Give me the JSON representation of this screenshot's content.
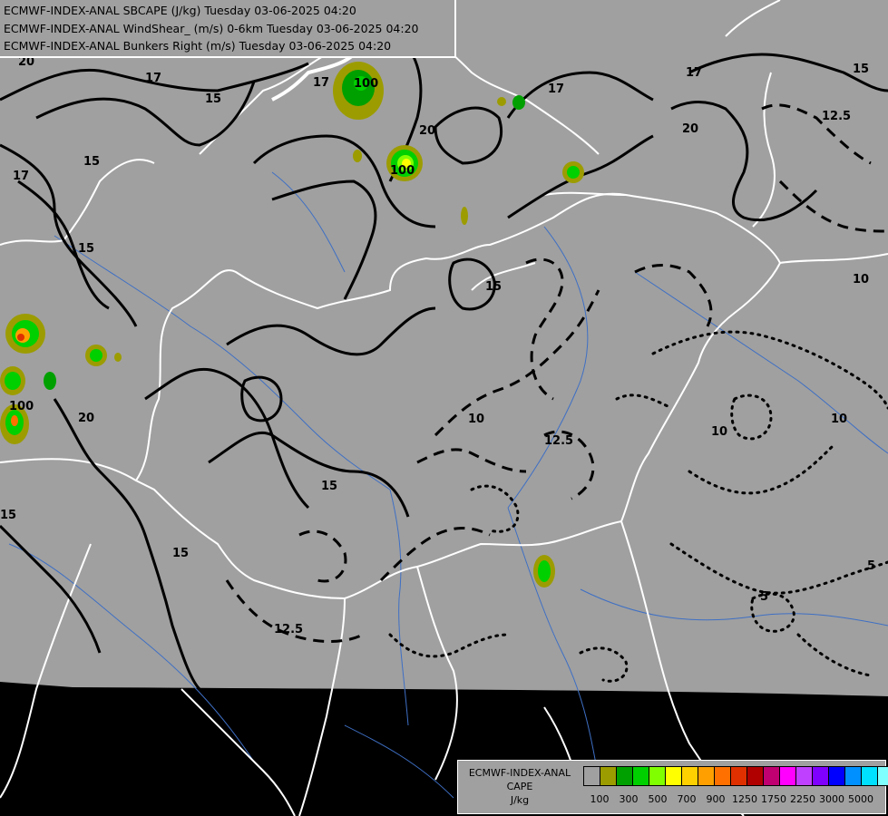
{
  "header": {
    "line1": "ECMWF-INDEX-ANAL SBCAPE (J/kg) Tuesday 03-06-2025 04:20",
    "line2": "ECMWF-INDEX-ANAL WindShear_ (m/s) 0-6km Tuesday 03-06-2025 04:20",
    "line3": "ECMWF-INDEX-ANAL Bunkers Right (m/s) Tuesday 03-06-2025 04:20"
  },
  "contour_labels": [
    "20",
    "17",
    "15",
    "17",
    "15",
    "17",
    "20",
    "17",
    "12.5",
    "15",
    "17",
    "15",
    "15",
    "20",
    "100",
    "100",
    "15",
    "15",
    "12.5",
    "12.5",
    "10",
    "10",
    "10",
    "10",
    "5",
    "5",
    "20",
    "15",
    "100"
  ],
  "legend": {
    "line1": "ECMWF-INDEX-ANAL",
    "line2": "CAPE",
    "line3": "J/kg",
    "colors": [
      "#a0a0a0",
      "#9c9c00",
      "#00a000",
      "#00d000",
      "#80ff00",
      "#ffff00",
      "#ffd000",
      "#ffa000",
      "#ff7000",
      "#e03000",
      "#b00000",
      "#c00070",
      "#ff00ff",
      "#c040ff",
      "#8000ff",
      "#0000ff",
      "#0090ff",
      "#00e0ff",
      "#80ffff",
      "#ffffff"
    ],
    "ticks": [
      "100",
      "300",
      "500",
      "700",
      "900",
      "1250",
      "1750",
      "2250",
      "3000",
      "5000"
    ]
  }
}
